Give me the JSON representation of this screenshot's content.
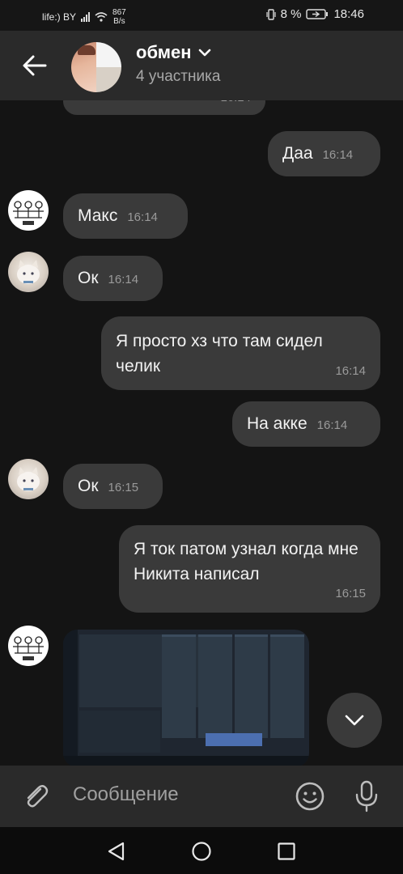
{
  "status_bar": {
    "carrier": "life:) BY",
    "speed_value": "867",
    "speed_unit": "B/s",
    "battery": "8 %",
    "time": "18:46"
  },
  "header": {
    "title": "обмен",
    "subtitle": "4 участника"
  },
  "messages": [
    {
      "side": "out",
      "text": "Даа",
      "time": "16:14"
    },
    {
      "side": "in",
      "avatar": "comic-avatar",
      "text": "Макс",
      "time": "16:14"
    },
    {
      "side": "in",
      "avatar": "cat-avatar",
      "text": "Ок",
      "time": "16:14"
    },
    {
      "side": "out",
      "text": "Я просто хз что там сидел челик",
      "time": "16:14"
    },
    {
      "side": "out",
      "text": "На акке",
      "time": "16:14"
    },
    {
      "side": "in",
      "avatar": "cat-avatar",
      "text": "Ок",
      "time": "16:15"
    },
    {
      "side": "out",
      "text": "Я ток патом узнал когда мне Никита написал",
      "time": "16:15"
    }
  ],
  "partial_top_time": "16:14",
  "composer": {
    "placeholder": "Сообщение"
  },
  "colors": {
    "background": "#141414",
    "bubble": "#3a3a3a",
    "header": "#2a2a2a"
  },
  "icons": [
    "back-arrow-icon",
    "chevron-down-icon",
    "attach-icon",
    "emoji-icon",
    "mic-icon",
    "nav-back-icon",
    "nav-home-icon",
    "nav-recents-icon"
  ]
}
